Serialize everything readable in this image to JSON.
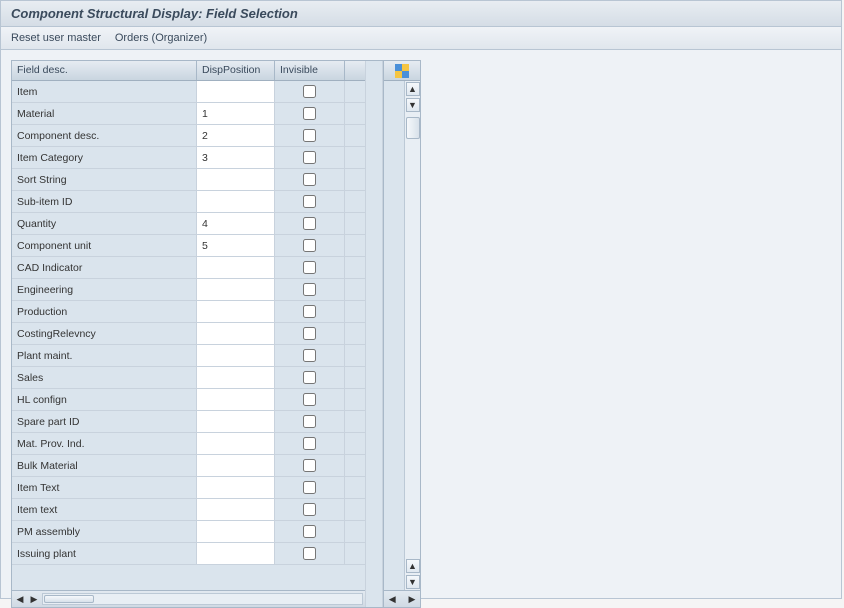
{
  "window": {
    "title": "Component Structural Display: Field Selection"
  },
  "toolbar": {
    "reset_user_master": "Reset user master",
    "orders_organizer": "Orders (Organizer)"
  },
  "grid": {
    "headers": {
      "field_desc": "Field desc.",
      "disp_position": "DispPosition",
      "invisible": "Invisible"
    },
    "config_icon": "table-config-icon",
    "rows": [
      {
        "field": "Item",
        "pos": "",
        "inv": false
      },
      {
        "field": "Material",
        "pos": "1",
        "inv": false
      },
      {
        "field": "Component desc.",
        "pos": "2",
        "inv": false
      },
      {
        "field": "Item Category",
        "pos": "3",
        "inv": false
      },
      {
        "field": "Sort String",
        "pos": "",
        "inv": false
      },
      {
        "field": "Sub-item ID",
        "pos": "",
        "inv": false
      },
      {
        "field": "Quantity",
        "pos": "4",
        "inv": false
      },
      {
        "field": "Component unit",
        "pos": "5",
        "inv": false
      },
      {
        "field": "CAD Indicator",
        "pos": "",
        "inv": false
      },
      {
        "field": "Engineering",
        "pos": "",
        "inv": false
      },
      {
        "field": "Production",
        "pos": "",
        "inv": false
      },
      {
        "field": "CostingRelevncy",
        "pos": "",
        "inv": false
      },
      {
        "field": "Plant maint.",
        "pos": "",
        "inv": false
      },
      {
        "field": "Sales",
        "pos": "",
        "inv": false
      },
      {
        "field": "HL confign",
        "pos": "",
        "inv": false
      },
      {
        "field": "Spare part ID",
        "pos": "",
        "inv": false
      },
      {
        "field": "Mat. Prov. Ind.",
        "pos": "",
        "inv": false
      },
      {
        "field": "Bulk Material",
        "pos": "",
        "inv": false
      },
      {
        "field": "Item Text",
        "pos": "",
        "inv": false
      },
      {
        "field": "Item text",
        "pos": "",
        "inv": false
      },
      {
        "field": "PM assembly",
        "pos": "",
        "inv": false
      },
      {
        "field": "Issuing plant",
        "pos": "",
        "inv": false
      }
    ]
  }
}
